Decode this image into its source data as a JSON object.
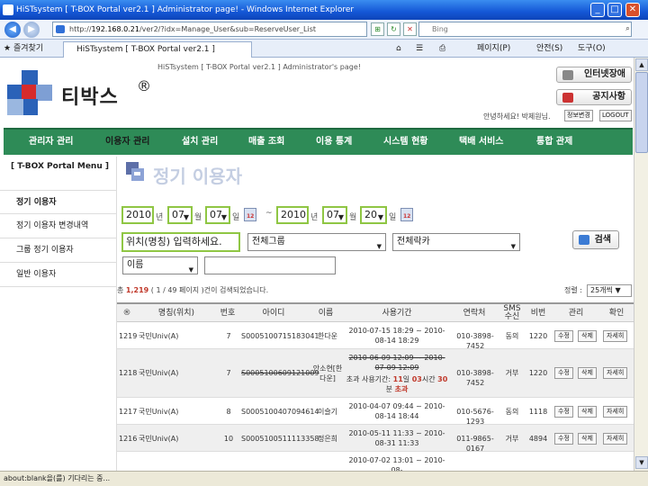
{
  "window": {
    "title": "HiSTsystem [ T-BOX Portal ver2.1 ] Administrator page! - Windows Internet Explorer"
  },
  "browser": {
    "url_prefix": "http://",
    "url_host": "192.168.0.21",
    "url_path": "/ver2/?idx=Manage_User&sub=ReserveUser_List",
    "search_placeholder": "Bing",
    "favorites_label": "즐겨찾기",
    "tab_title": "HiSTsystem [ T-BOX Portal ver2.1 ] Adminis...",
    "toolbar": {
      "page": "페이지(P)",
      "safety": "안전(S)",
      "tools": "도구(O)"
    },
    "status_text": "about:blank을(를) 기다리는 중..."
  },
  "header": {
    "brand": "티박스",
    "reg_mark": "®",
    "subtitle": "HiSTsystem [ T-BOX Portal ver2.1 ] Administrator's page!",
    "btn_internet": "인터넷장애",
    "btn_notice": "공지사항",
    "greeting": "안녕하세요! 박제원님.",
    "btn_info_change": "정보변경",
    "btn_logout": "LOGOUT"
  },
  "menu": [
    "관리자 관리",
    "이용자 관리",
    "설치 관리",
    "매출 조회",
    "이용 통계",
    "시스템 현황",
    "택배 서비스",
    "통합 관제"
  ],
  "sidebar": {
    "header": "[ T-BOX Portal Menu ]",
    "items": [
      "정기 이용자",
      "정기 이용자 변경내역",
      "그룹 정기 이용자",
      "일반 이용자"
    ]
  },
  "page": {
    "title": "정기 이용자"
  },
  "filters": {
    "from_year": "2010",
    "from_month": "07",
    "from_day": "07",
    "to_year": "2010",
    "to_month": "07",
    "to_day": "20",
    "year_unit": "년",
    "month_unit": "월",
    "day_unit": "일",
    "range_sep": "~",
    "location_placeholder": "위치(명칭) 입력하세요.",
    "group_select": "전체그룹",
    "rack_select": "전체락카",
    "field_select": "이름",
    "search_button": "검색"
  },
  "results": {
    "prefix": "총",
    "total": "1,219",
    "paging": "( 1 / 49 페이지 )건이 검색되었습니다.",
    "sort_label": "정렬 :",
    "sort_value": "25개씩"
  },
  "table": {
    "headers": [
      "®",
      "명칭(위치)",
      "번호",
      "아이디",
      "이름",
      "사용기간",
      "연락처",
      "SMS 수신",
      "비번",
      "관리",
      "확인"
    ],
    "action_labels": [
      "수정",
      "삭제",
      "자세히"
    ],
    "rows": [
      {
        "no": "1219",
        "place": "국민Univ(A)",
        "num": "7",
        "id": "S0005100715183041",
        "name": "한다운",
        "period": "2010-07-15 18:29 ~ 2010-08-14 18:29",
        "phone": "010-3898-7452",
        "sms": "동의",
        "pw": "1220"
      },
      {
        "no": "1218",
        "place": "국민Univ(A)",
        "num": "7",
        "id": "S0005100609121009",
        "name": "안소현[한다운]",
        "period_old": "2010-06-09 12:09 ~ 2010-07-09 12:09",
        "period_note_a": "초과 사용기간:",
        "over_days": "11",
        "day_unit": "일",
        "over_hours": "03",
        "hour_unit": "시간",
        "over_min": "30",
        "min_unit": "분",
        "over_label": "초과",
        "phone": "010-3898-7452",
        "sms": "거부",
        "pw": "1220"
      },
      {
        "no": "1217",
        "place": "국민Univ(A)",
        "num": "8",
        "id": "S0005100407094614",
        "name": "이슬기",
        "period": "2010-04-07 09:44 ~ 2010-08-14 18:44",
        "phone": "010-5676-1293",
        "sms": "동의",
        "pw": "1118"
      },
      {
        "no": "1216",
        "place": "국민Univ(A)",
        "num": "10",
        "id": "S0005100511113358",
        "name": "정은희",
        "period": "2010-05-11 11:33 ~ 2010-08-31 11:33",
        "phone": "011-9865-0167",
        "sms": "거부",
        "pw": "4894"
      },
      {
        "partial_period": "2010-07-02 13:01 ~ 2010-08-"
      }
    ]
  }
}
